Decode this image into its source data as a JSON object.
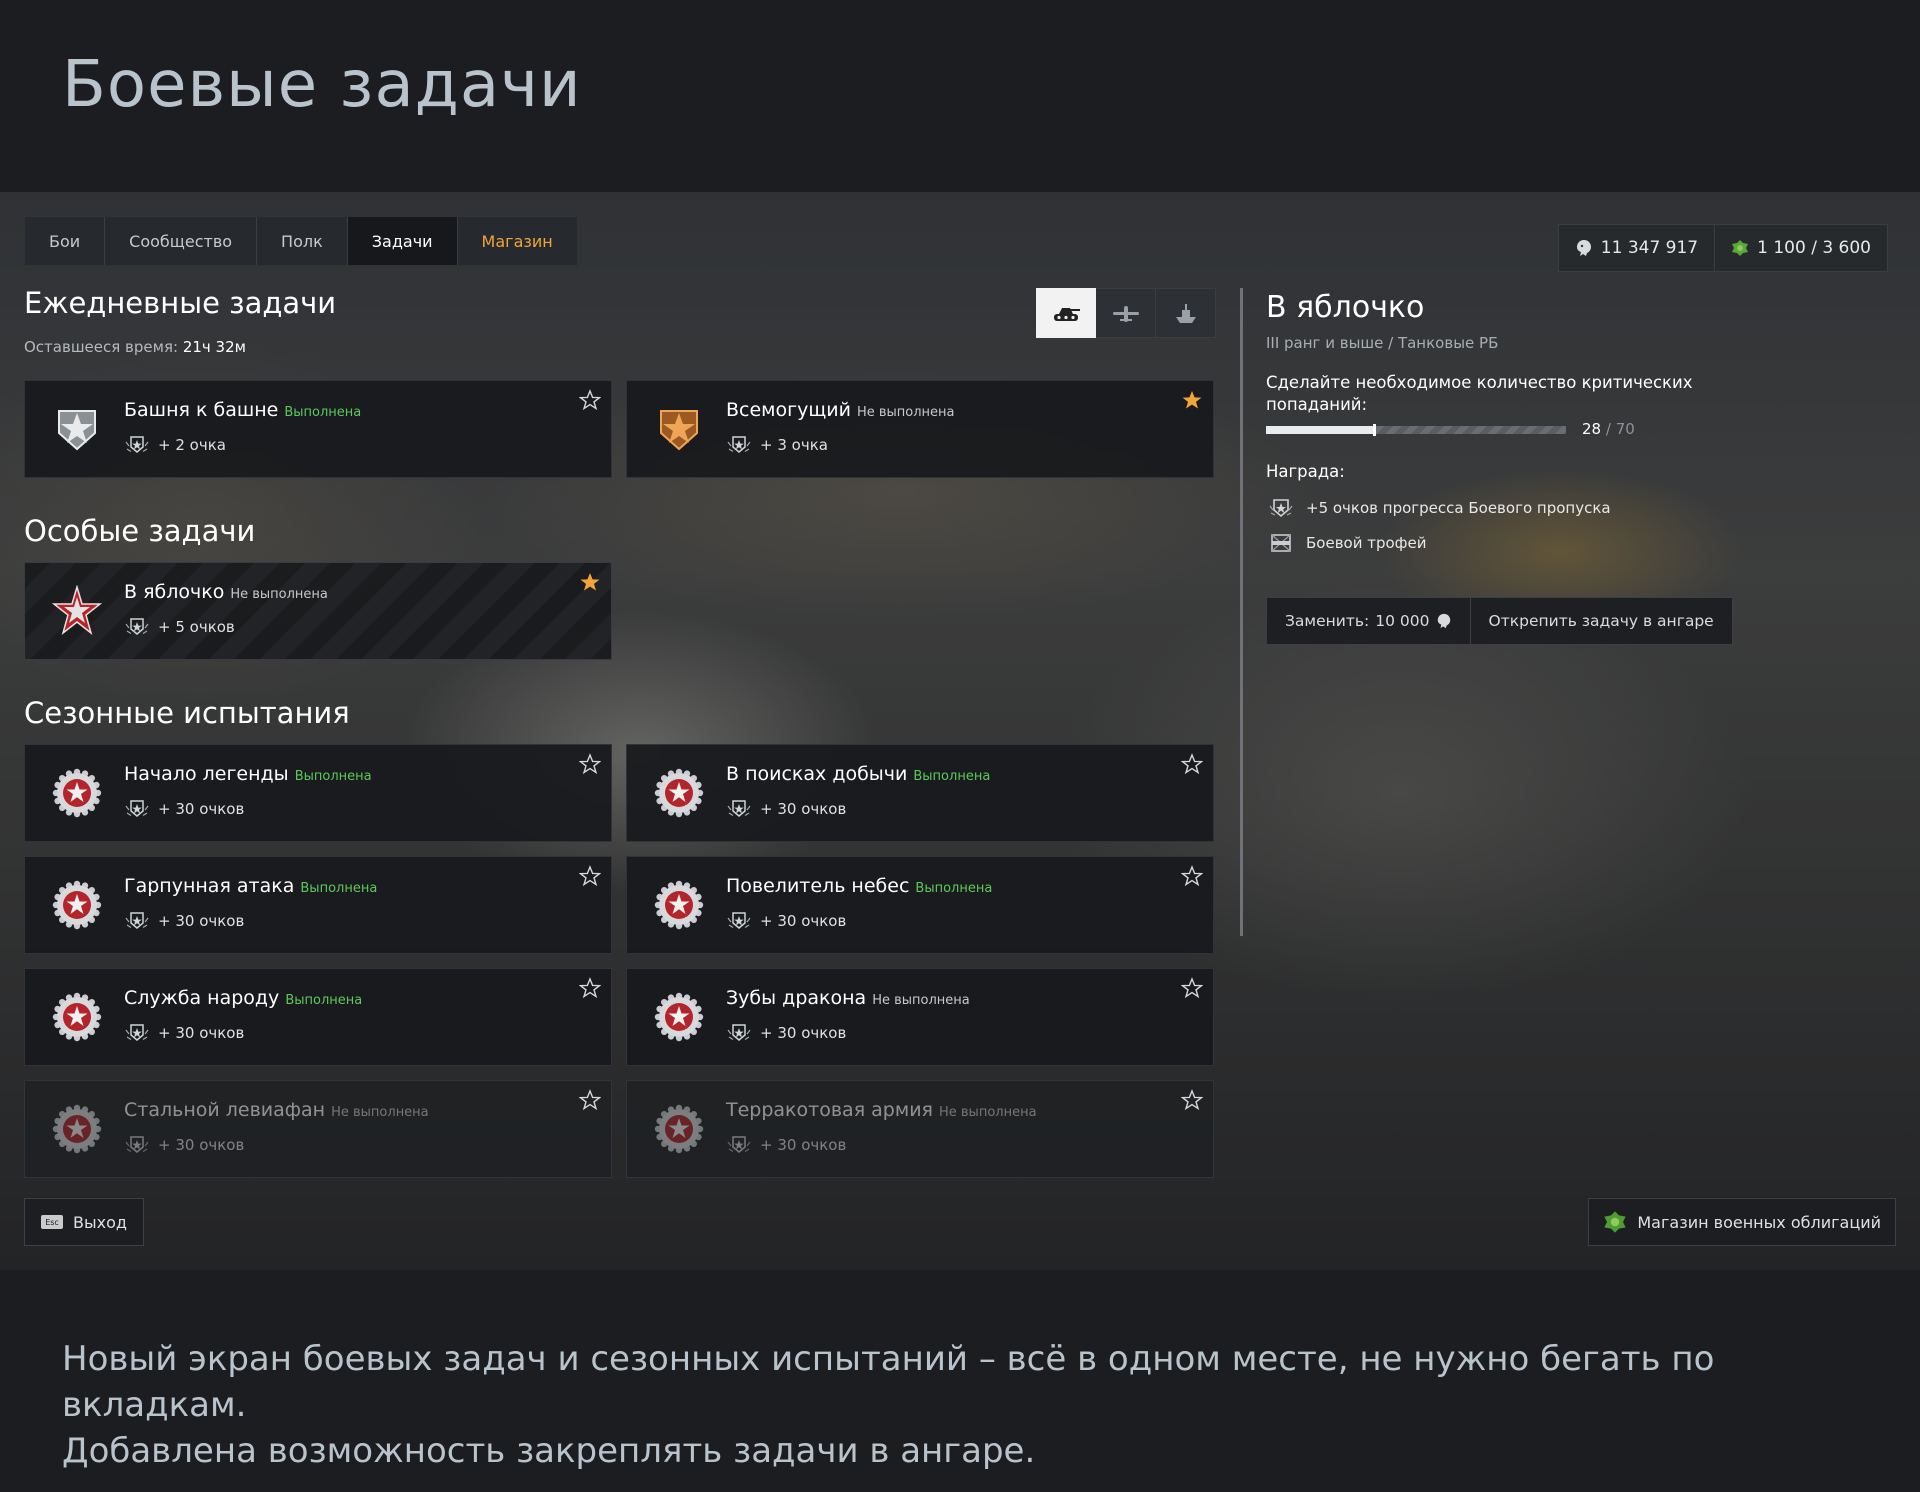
{
  "page_title": "Боевые задачи",
  "tabs": [
    {
      "label": "Бои"
    },
    {
      "label": "Сообщество"
    },
    {
      "label": "Полк"
    },
    {
      "label": "Задачи"
    },
    {
      "label": "Магазин"
    }
  ],
  "currency": {
    "silver": "11 347 917",
    "bonds": "1 100 / 3 600"
  },
  "daily": {
    "title": "Ежедневные задачи",
    "time_label": "Оставшееся время:",
    "time_value": "21ч 32м",
    "vehicle_filters": [
      "tank-icon",
      "plane-icon",
      "ship-icon"
    ],
    "cards": [
      {
        "name": "Башня к башне",
        "status": "Выполнена",
        "points": "+ 2 очка",
        "emblem": "silver-star-emblem",
        "pinned": false
      },
      {
        "name": "Всемогущий",
        "status": "Не выполнена",
        "points": "+ 3 очка",
        "emblem": "bronze-star-emblem",
        "pinned": true
      }
    ]
  },
  "special": {
    "title": "Особые задачи",
    "cards": [
      {
        "name": "В яблочко",
        "status": "Не выполнена",
        "points": "+ 5 очков",
        "emblem": "red-star-emblem",
        "pinned": true
      }
    ]
  },
  "seasonal": {
    "title": "Сезонные испытания",
    "cards": [
      {
        "name": "Начало легенды",
        "status": "Выполнена",
        "points": "+ 30 очков",
        "pinned": false
      },
      {
        "name": "В поисках добычи",
        "status": "Выполнена",
        "points": "+ 30 очков",
        "pinned": false
      },
      {
        "name": "Гарпунная атака",
        "status": "Выполнена",
        "points": "+ 30 очков",
        "pinned": false
      },
      {
        "name": "Повелитель небес",
        "status": "Выполнена",
        "points": "+ 30 очков",
        "pinned": false
      },
      {
        "name": "Служба народу",
        "status": "Выполнена",
        "points": "+ 30 очков",
        "pinned": false
      },
      {
        "name": "Зубы дракона",
        "status": "Не выполнена",
        "points": "+ 30 очков",
        "pinned": false
      },
      {
        "name": "Стальной левиафан",
        "status": "Не выполнена",
        "points": "+ 30 очков",
        "pinned": false
      },
      {
        "name": "Терракотовая армия",
        "status": "Не выполнена",
        "points": "+ 30 очков",
        "pinned": false
      }
    ]
  },
  "detail": {
    "title": "В яблочко",
    "subtitle": "III ранг и выше / Танковые РБ",
    "description": "Сделайте необходимое количество критических попаданий:",
    "progress_current": "28",
    "progress_max": "/ 70",
    "progress_fraction": 0.4,
    "reward_label": "Награда:",
    "rewards": [
      {
        "icon": "battle-pass-points-icon",
        "text": "+5 очков прогресса Боевого пропуска"
      },
      {
        "icon": "trophy-crate-icon",
        "text": "Боевой трофей"
      }
    ],
    "replace_label": "Заменить:",
    "replace_cost": "10 000",
    "unpin_label": "Открепить задачу в ангаре"
  },
  "footer": {
    "esc_key": "Esc",
    "exit_label": "Выход",
    "bonds_shop_label": "Магазин военных облигаций"
  },
  "caption": {
    "line1": "Новый экран боевых задач и сезонных испытаний – всё в одном месте, не нужно бегать по вкладкам.",
    "line2": "Добавлена возможность закреплять задачи в ангаре."
  },
  "colors": {
    "done": "#5cc95a",
    "shop_tab": "#f0a43a",
    "star_pinned": "#f0a43a"
  }
}
